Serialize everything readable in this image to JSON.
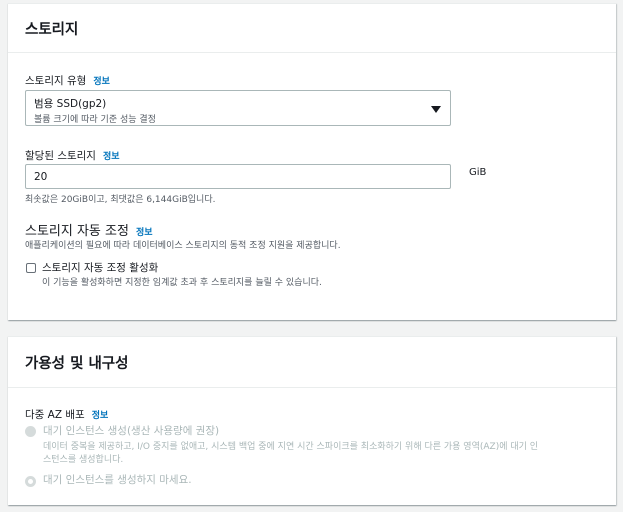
{
  "storage": {
    "title": "스토리지",
    "storage_type": {
      "label": "스토리지 유형",
      "info": "정보",
      "selected": "범용 SSD(gp2)",
      "description": "볼륨 크기에 따라 기준 성능 결정"
    },
    "allocated": {
      "label": "할당된 스토리지",
      "info": "정보",
      "value": "20",
      "unit": "GiB",
      "hint": "최솟값은 20GiB이고, 최댓값은 6,144GiB입니다."
    },
    "autoscaling": {
      "title": "스토리지 자동 조정",
      "info": "정보",
      "description": "애플리케이션의 필요에 따라 데이터베이스 스토리지의 동적 조정 지원을 제공합니다.",
      "checkbox_label": "스토리지 자동 조정 활성화",
      "checkbox_description": "이 기능을 활성화하면 지정한 임계값 초과 후 스토리지를 늘릴 수 있습니다.",
      "checked": false
    }
  },
  "availability": {
    "title": "가용성 및 내구성",
    "multi_az": {
      "label": "다중 AZ 배포",
      "info": "정보",
      "option1_label": "대기 인스턴스 생성(생산 사용량에 권장)",
      "option1_desc_line1": "데이터 중복을 제공하고, I/O 중지를 없애고, 시스템 백업 중에 지연 시간 스파이크를 최소화하기 위해 다른 가용 영역(AZ)에 대기 인",
      "option1_desc_line2": "스턴스를 생성합니다.",
      "option2_label": "대기 인스턴스를 생성하지 마세요."
    }
  }
}
